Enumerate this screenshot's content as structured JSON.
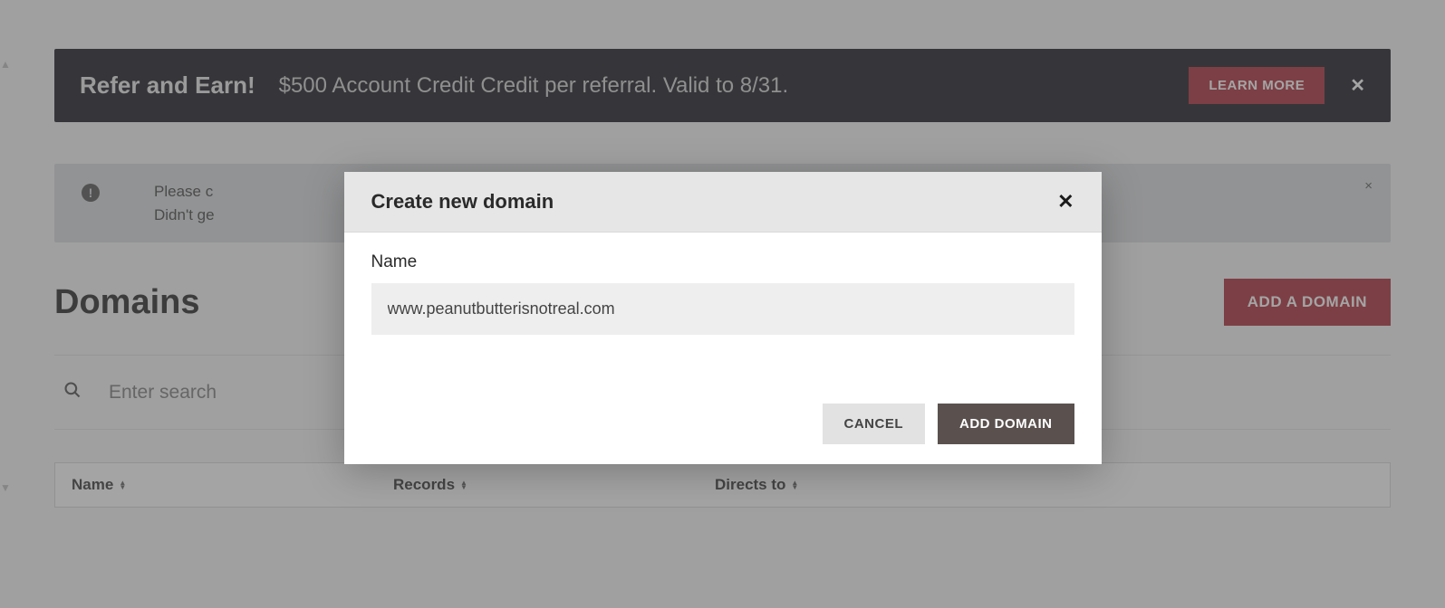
{
  "banner": {
    "title": "Refer and Earn!",
    "text": "$500 Account Credit Credit per referral. Valid to 8/31.",
    "learn_more": "LEARN MORE",
    "close": "✕"
  },
  "alert": {
    "line1": "Please c",
    "line2": "Didn't ge",
    "close": "×"
  },
  "page": {
    "title": "Domains",
    "add_button": "ADD A DOMAIN"
  },
  "search": {
    "placeholder": "Enter search"
  },
  "table": {
    "col_name": "Name",
    "col_records": "Records",
    "col_directs": "Directs to"
  },
  "modal": {
    "title": "Create new domain",
    "close": "✕",
    "field_label": "Name",
    "field_value": "www.peanutbutterisnotreal.com",
    "cancel": "CANCEL",
    "submit": "ADD DOMAIN"
  }
}
